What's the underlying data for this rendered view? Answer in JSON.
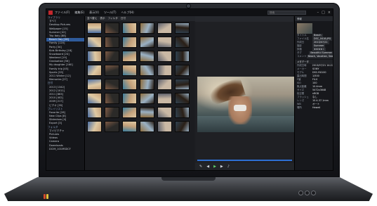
{
  "app": {
    "menus": [
      "ファイル(F)",
      "編集(E)",
      "表示(V)",
      "ツール(T)",
      "ヘルプ(H)"
    ],
    "title": "Vegas-like Media Browser",
    "search_placeholder": "検索"
  },
  "sidebar": {
    "items": [
      {
        "label": "ライブラリ",
        "type": "head"
      },
      {
        "label": "すべて",
        "type": "item"
      },
      {
        "label": "Desktop Pictures",
        "type": "item"
      },
      {
        "label": "Wallpaper [15]",
        "type": "item"
      },
      {
        "label": "Summer [42]",
        "type": "item"
      },
      {
        "label": "Trip Italy [88]",
        "type": "item"
      },
      {
        "label": "Beach Day [26]",
        "type": "selected"
      },
      {
        "label": "Family [120]",
        "type": "item"
      },
      {
        "label": "Party [34]",
        "type": "item"
      },
      {
        "label": "Kids Birthday [18]",
        "type": "item"
      },
      {
        "label": "Snowboard [24]",
        "type": "item"
      },
      {
        "label": "Weekend [19]",
        "type": "item"
      },
      {
        "label": "Graduation [56]",
        "type": "item"
      },
      {
        "label": "My daughter [160]",
        "type": "item"
      },
      {
        "label": "Family trip [45]",
        "type": "item"
      },
      {
        "label": "Sports [33]",
        "type": "item"
      },
      {
        "label": "2011 Winter [12]",
        "type": "item"
      },
      {
        "label": "Memories [27]",
        "type": "item"
      },
      {
        "label": "日付",
        "type": "head"
      },
      {
        "label": "2013 [1342]",
        "type": "item"
      },
      {
        "label": "2012 [1011]",
        "type": "item"
      },
      {
        "label": "2011 [863]",
        "type": "item"
      },
      {
        "label": "2010 [402]",
        "type": "item"
      },
      {
        "label": "2009 [217]",
        "type": "item"
      },
      {
        "label": "ビデオ [35]",
        "type": "item"
      },
      {
        "label": "プレイリスト",
        "type": "head"
      },
      {
        "label": "Favorite [28]",
        "type": "item"
      },
      {
        "label": "New Clips [8]",
        "type": "item"
      },
      {
        "label": "Slideshow [4]",
        "type": "item"
      },
      {
        "label": "Export [3]",
        "type": "item"
      },
      {
        "label": "フォルダ",
        "type": "head"
      },
      {
        "label": "マイピクチャ",
        "type": "item"
      },
      {
        "label": "Pictures",
        "type": "item"
      },
      {
        "label": "Videos",
        "type": "item"
      },
      {
        "label": "Camera",
        "type": "item"
      },
      {
        "label": "Downloads",
        "type": "item"
      },
      {
        "label": "DCIM_101MSDCF",
        "type": "item"
      }
    ]
  },
  "grid_toolbar": {
    "items": [
      "並べ替え",
      "表示",
      "フィルタ",
      "日付"
    ]
  },
  "panel": {
    "header": "情報",
    "fields": [
      {
        "k": "タイトル",
        "v": "Beach"
      },
      {
        "k": "ファイル名",
        "v": "DSC_0418.JPG"
      },
      {
        "k": "作成日",
        "v": "2013/07/21"
      },
      {
        "k": "撮影",
        "v": "Summer"
      },
      {
        "k": "評価",
        "v": "★★★★☆"
      },
      {
        "k": "タグ",
        "v": "Beautiful Summer"
      },
      {
        "k": "コメント",
        "v": "Beach, Vacation, Sea"
      }
    ],
    "section": "メタデータ",
    "meta": [
      {
        "k": "作成日時",
        "v": "2013/07/21 14:22"
      },
      {
        "k": "メーカー",
        "v": "SONY"
      },
      {
        "k": "モデル",
        "v": "DSC-RX100"
      },
      {
        "k": "露出時間",
        "v": "1/500"
      },
      {
        "k": "F値",
        "v": "F4.0"
      },
      {
        "k": "ISO",
        "v": "100"
      },
      {
        "k": "焦点距離",
        "v": "10.4mm"
      },
      {
        "k": "サイズ",
        "v": "5472x3648"
      },
      {
        "k": "色空間",
        "v": "sRGB"
      },
      {
        "k": "フラッシュ",
        "v": "なし"
      },
      {
        "k": "レンズ",
        "v": "10.4-37.1mm"
      },
      {
        "k": "WB",
        "v": "オート"
      },
      {
        "k": "場所",
        "v": "Hawaii"
      }
    ]
  },
  "colors": {
    "accent": "#2f5b9b",
    "timeline": "#2d6fd2",
    "brand_red": "#c2272d",
    "play": "#5ed06b"
  },
  "thumb_palettes": [
    [
      "#4b6ea3",
      "#c3a07a"
    ],
    [
      "#7d5a45",
      "#2b2a28"
    ],
    [
      "#3c7d9d",
      "#dfc9a3"
    ],
    [
      "#8d6d3e",
      "#2a1f16"
    ],
    [
      "#5b5f6b",
      "#c9b8a4"
    ],
    [
      "#2f4150",
      "#9ab1c4"
    ]
  ]
}
